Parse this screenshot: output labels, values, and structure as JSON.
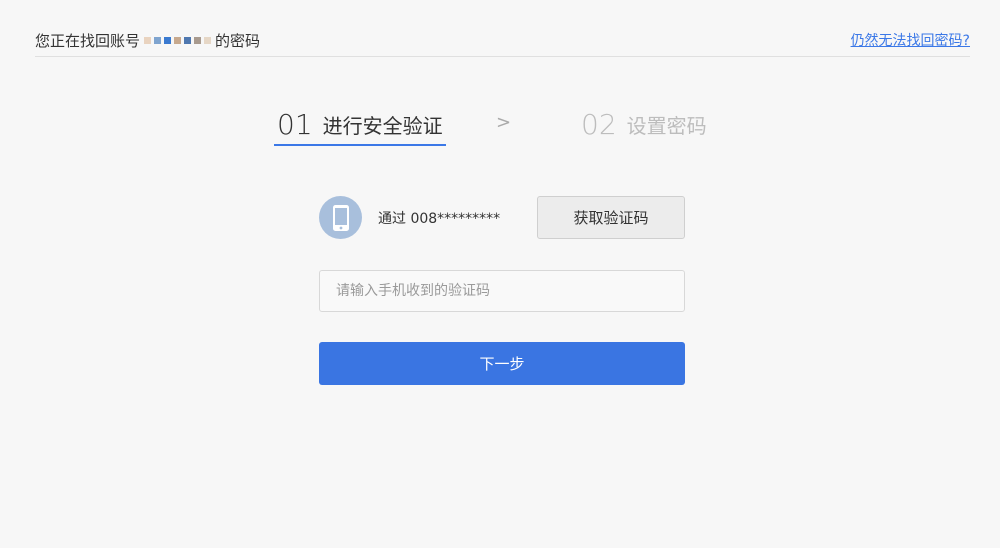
{
  "header": {
    "prefix": "您正在找回账号",
    "suffix": "的密码",
    "help_link": "仍然无法找回密码?"
  },
  "steps": [
    {
      "number": "01",
      "label": "进行安全验证",
      "active": true
    },
    {
      "number": "02",
      "label": "设置密码",
      "active": false
    }
  ],
  "step_arrow": ">",
  "verify": {
    "method_text": "通过 008*********",
    "get_code_label": "获取验证码"
  },
  "code_input": {
    "placeholder": "请输入手机收到的验证码",
    "value": ""
  },
  "next_label": "下一步",
  "colors": {
    "accent": "#3a75e2",
    "link": "#3b78e7",
    "avatar": "#a8bfdc",
    "background": "#f7f7f7"
  },
  "icons": {
    "phone": "mobile-phone-icon"
  }
}
